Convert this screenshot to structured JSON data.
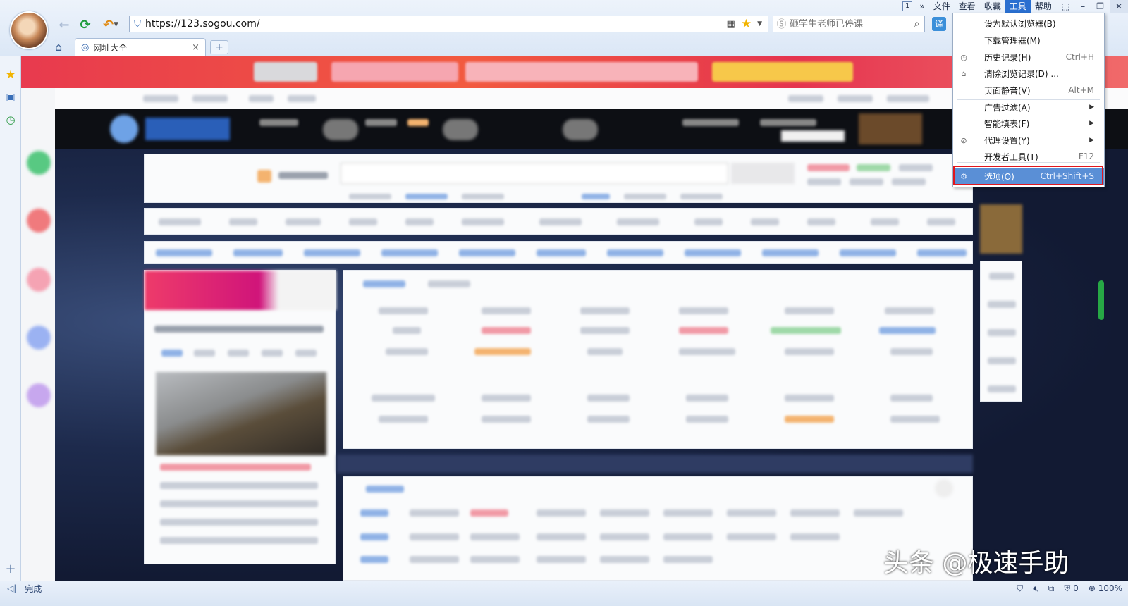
{
  "menubar": {
    "pager": "1",
    "more": "»",
    "items": [
      "文件",
      "查看",
      "收藏",
      "工具",
      "帮助"
    ],
    "active": "工具",
    "window_buttons": [
      "⬚",
      "–",
      "❐",
      "✕"
    ]
  },
  "toolbar": {
    "url": "https://123.sogou.com/",
    "search_placeholder": "砸学生老师已停课"
  },
  "tab": {
    "title": "网址大全",
    "close": "×",
    "new_tab": "+"
  },
  "tools_menu": {
    "items": [
      {
        "label": "设为默认浏览器(B)",
        "shortcut": "",
        "icon": "",
        "arrow": false
      },
      {
        "label": "下载管理器(M)",
        "shortcut": "",
        "icon": "",
        "arrow": false
      },
      {
        "label": "历史记录(H)",
        "shortcut": "Ctrl+H",
        "icon": "clock-icon",
        "arrow": false
      },
      {
        "label": "清除浏览记录(D) ...",
        "shortcut": "",
        "icon": "broom-icon",
        "arrow": false
      },
      {
        "label": "页面静音(V)",
        "shortcut": "Alt+M",
        "icon": "",
        "arrow": false
      },
      {
        "label": "广告过滤(A)",
        "shortcut": "",
        "icon": "",
        "arrow": true
      },
      {
        "label": "智能填表(F)",
        "shortcut": "",
        "icon": "",
        "arrow": true
      },
      {
        "label": "代理设置(Y)",
        "shortcut": "",
        "icon": "link-icon",
        "arrow": true
      },
      {
        "label": "开发者工具(T)",
        "shortcut": "F12",
        "icon": "",
        "arrow": false
      },
      {
        "label": "选项(O)",
        "shortcut": "Ctrl+Shift+S",
        "icon": "gear-icon",
        "arrow": false,
        "highlighted": true
      }
    ]
  },
  "statusbar": {
    "status": "完成",
    "counter": "0",
    "zoom": "100%"
  },
  "watermark": "头条 @极速手助",
  "colors": {
    "accent": "#2a6fd0",
    "menu_highlight": "#5a8fd6",
    "annotation_red": "#e0161d",
    "scroll_thumb": "#27a845"
  }
}
